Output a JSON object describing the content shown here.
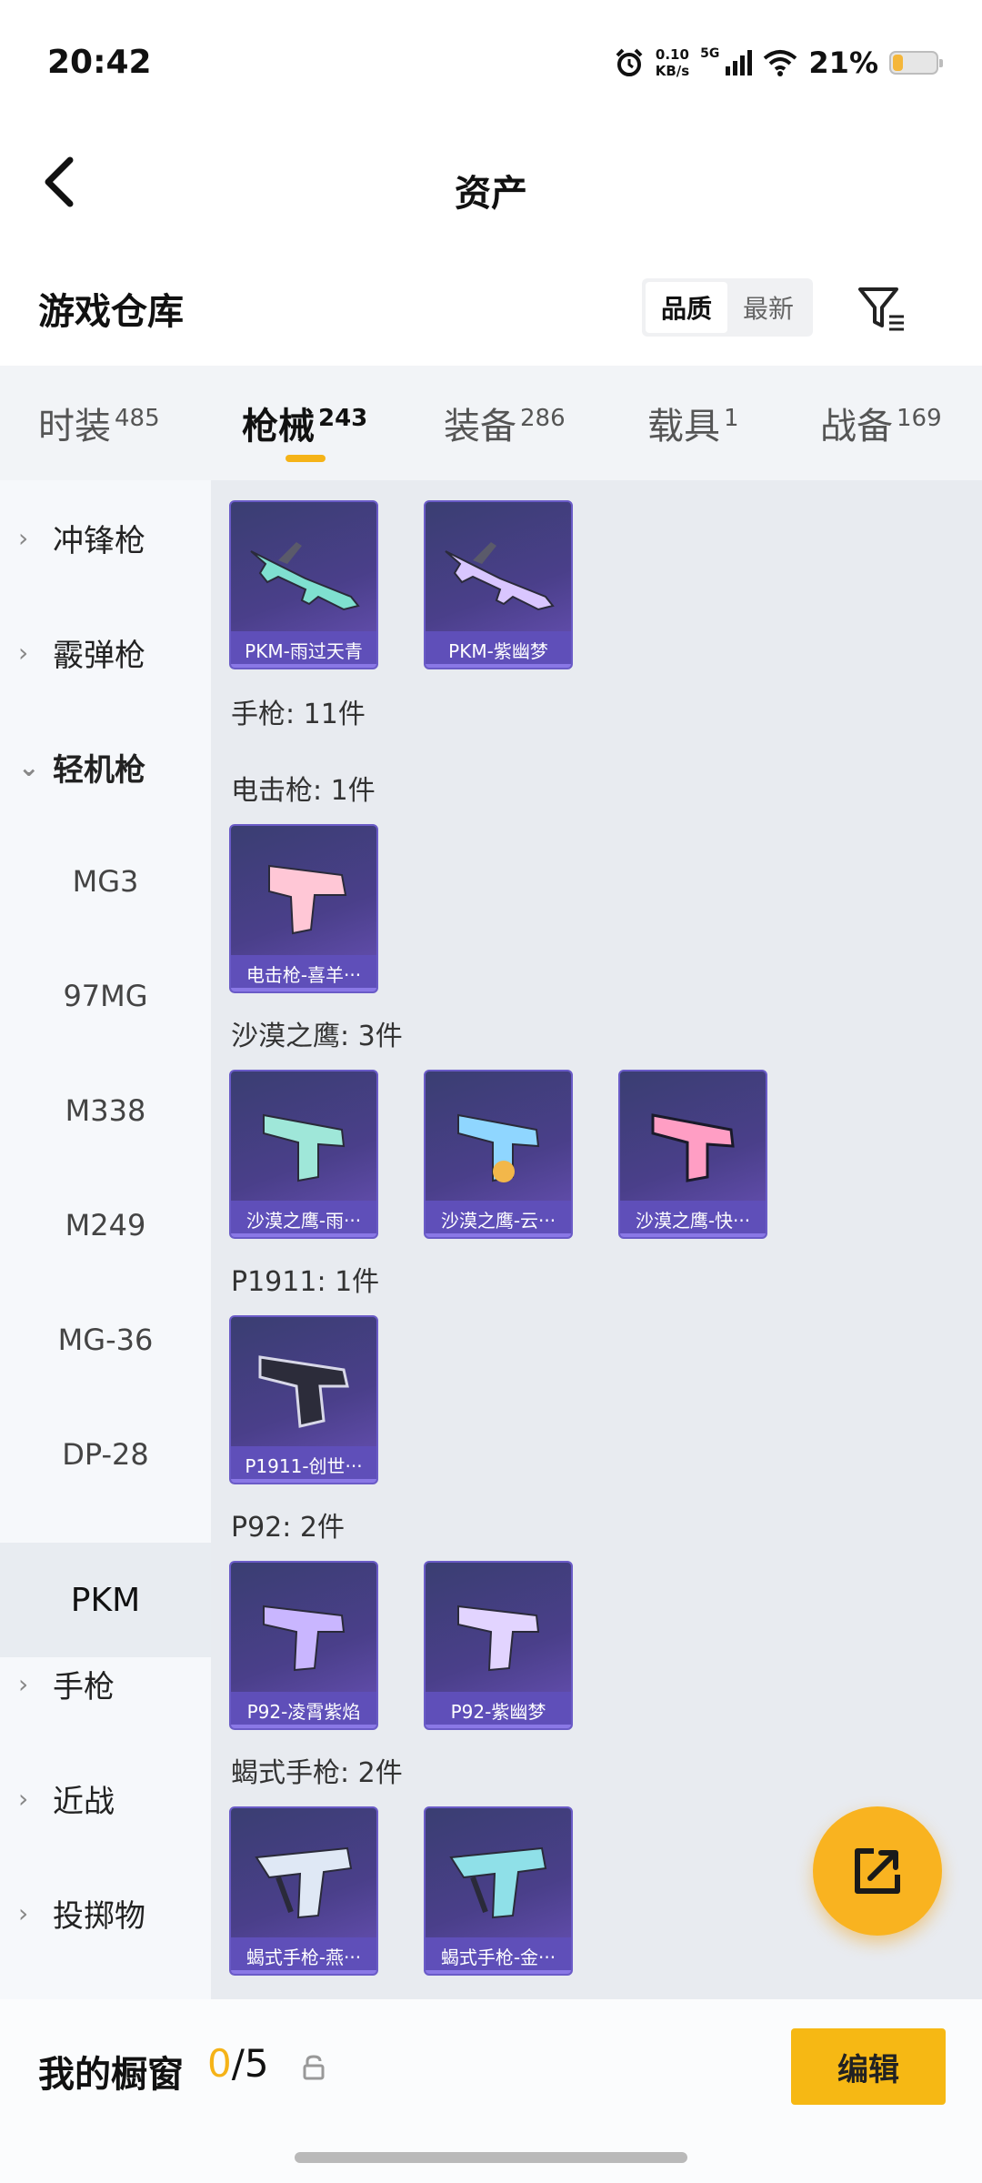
{
  "status": {
    "time": "20:42",
    "net_speed": "0.10",
    "net_unit": "KB/s",
    "network": "5G",
    "battery_pct": "21%",
    "battery_level": 0.21
  },
  "header": {
    "title": "资产"
  },
  "warehouse": {
    "title": "游戏仓库",
    "sort_options": [
      "品质",
      "最新"
    ]
  },
  "tabs": [
    {
      "label": "时装",
      "count": "485"
    },
    {
      "label": "枪械",
      "count": "243"
    },
    {
      "label": "装备",
      "count": "286"
    },
    {
      "label": "载具",
      "count": "1"
    },
    {
      "label": "战备",
      "count": "169"
    }
  ],
  "sidebar": {
    "items": [
      {
        "label": "冲锋枪",
        "chevron": "›"
      },
      {
        "label": "霰弹枪",
        "chevron": "›"
      },
      {
        "label": "轻机枪",
        "chevron": "⌄"
      },
      {
        "label": "MG3"
      },
      {
        "label": "97MG"
      },
      {
        "label": "M338"
      },
      {
        "label": "M249"
      },
      {
        "label": "MG-36"
      },
      {
        "label": "DP-28"
      },
      {
        "label": "PKM"
      },
      {
        "label": "手枪",
        "chevron": "›"
      },
      {
        "label": "近战",
        "chevron": "›"
      },
      {
        "label": "投掷物",
        "chevron": "›"
      }
    ]
  },
  "content": {
    "top_cards": [
      {
        "label": "PKM-雨过天青",
        "accent": "#7fe0d0"
      },
      {
        "label": "PKM-紫幽梦",
        "accent": "#d9c6ff"
      }
    ],
    "groups": [
      {
        "title": "手枪: 11件",
        "cards": []
      },
      {
        "title": "电击枪: 1件",
        "cards": [
          {
            "label": "电击枪-喜羊···",
            "accent": "#ffc7d6"
          }
        ]
      },
      {
        "title": "沙漠之鹰: 3件",
        "cards": [
          {
            "label": "沙漠之鹰-雨···",
            "accent": "#9fe7d9"
          },
          {
            "label": "沙漠之鹰-云···",
            "accent": "#8fd6ff"
          },
          {
            "label": "沙漠之鹰-快···",
            "accent": "#ff9ec4"
          }
        ]
      },
      {
        "title": "P1911: 1件",
        "cards": [
          {
            "label": "P1911-创世···",
            "accent": "#d8d8e8"
          }
        ]
      },
      {
        "title": "P92: 2件",
        "cards": [
          {
            "label": "P92-凌霄紫焰",
            "accent": "#c9b6ff"
          },
          {
            "label": "P92-紫幽梦",
            "accent": "#e2d4ff"
          }
        ]
      },
      {
        "title": "蝎式手枪: 2件",
        "cards": [
          {
            "label": "蝎式手枪-燕···",
            "accent": "#dfe8f5"
          },
          {
            "label": "蝎式手枪-金···",
            "accent": "#8fe0e8"
          }
        ]
      }
    ]
  },
  "showcase": {
    "title": "我的橱窗",
    "current": "0",
    "total": "/5",
    "edit_label": "编辑"
  },
  "colors": {
    "accent": "#f5b318",
    "card_bg": "#4a3f8a"
  }
}
